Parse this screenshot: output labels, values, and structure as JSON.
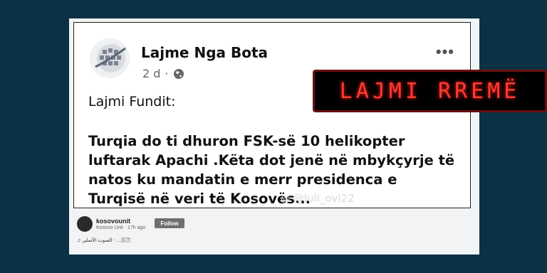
{
  "post": {
    "page_name": "Lajme Nga Bota",
    "time": "2 d",
    "separator": "·",
    "more_label": "•••",
    "lead": "Lajmi Fundit:",
    "body": "Turqia do ti dhuron FSK-së 10 helikopter luftarak Apachi .Këta dot jenë në mbykçyrje të natos ku mandatin e merr presidenca e Turqisë në veri të Kosovës...",
    "watermark": "◎ @luli_ovi22"
  },
  "badge": {
    "text": "LAJMI RREMË",
    "color": "#ff3b2f"
  },
  "footer": {
    "username": "kosovounit",
    "subtitle": "Kosovo Unit · 17h ago",
    "follow_label": "Follow",
    "audio": "♫ الصوت الأصلي - ...🅂🅃"
  },
  "icons": {
    "globe": "globe-icon",
    "more": "more-options-icon"
  }
}
